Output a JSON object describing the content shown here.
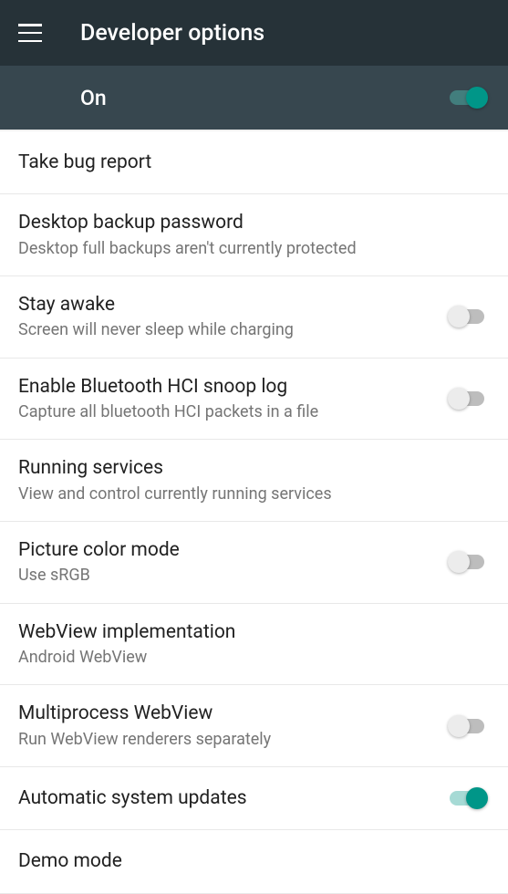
{
  "header": {
    "title": "Developer options"
  },
  "master": {
    "label": "On",
    "enabled": true
  },
  "settings": [
    {
      "key": "bug-report",
      "title": "Take bug report",
      "subtitle": null,
      "toggle": null
    },
    {
      "key": "backup-password",
      "title": "Desktop backup password",
      "subtitle": "Desktop full backups aren't currently protected",
      "toggle": null
    },
    {
      "key": "stay-awake",
      "title": "Stay awake",
      "subtitle": "Screen will never sleep while charging",
      "toggle": false
    },
    {
      "key": "bluetooth-hci",
      "title": "Enable Bluetooth HCI snoop log",
      "subtitle": "Capture all bluetooth HCI packets in a file",
      "toggle": false
    },
    {
      "key": "running-services",
      "title": "Running services",
      "subtitle": "View and control currently running services",
      "toggle": null
    },
    {
      "key": "picture-color",
      "title": "Picture color mode",
      "subtitle": "Use sRGB",
      "toggle": false
    },
    {
      "key": "webview-impl",
      "title": "WebView implementation",
      "subtitle": "Android WebView",
      "toggle": null
    },
    {
      "key": "multiprocess-webview",
      "title": "Multiprocess WebView",
      "subtitle": "Run WebView renderers separately",
      "toggle": false
    },
    {
      "key": "auto-updates",
      "title": "Automatic system updates",
      "subtitle": null,
      "toggle": true
    },
    {
      "key": "demo-mode",
      "title": "Demo mode",
      "subtitle": null,
      "toggle": null
    }
  ]
}
